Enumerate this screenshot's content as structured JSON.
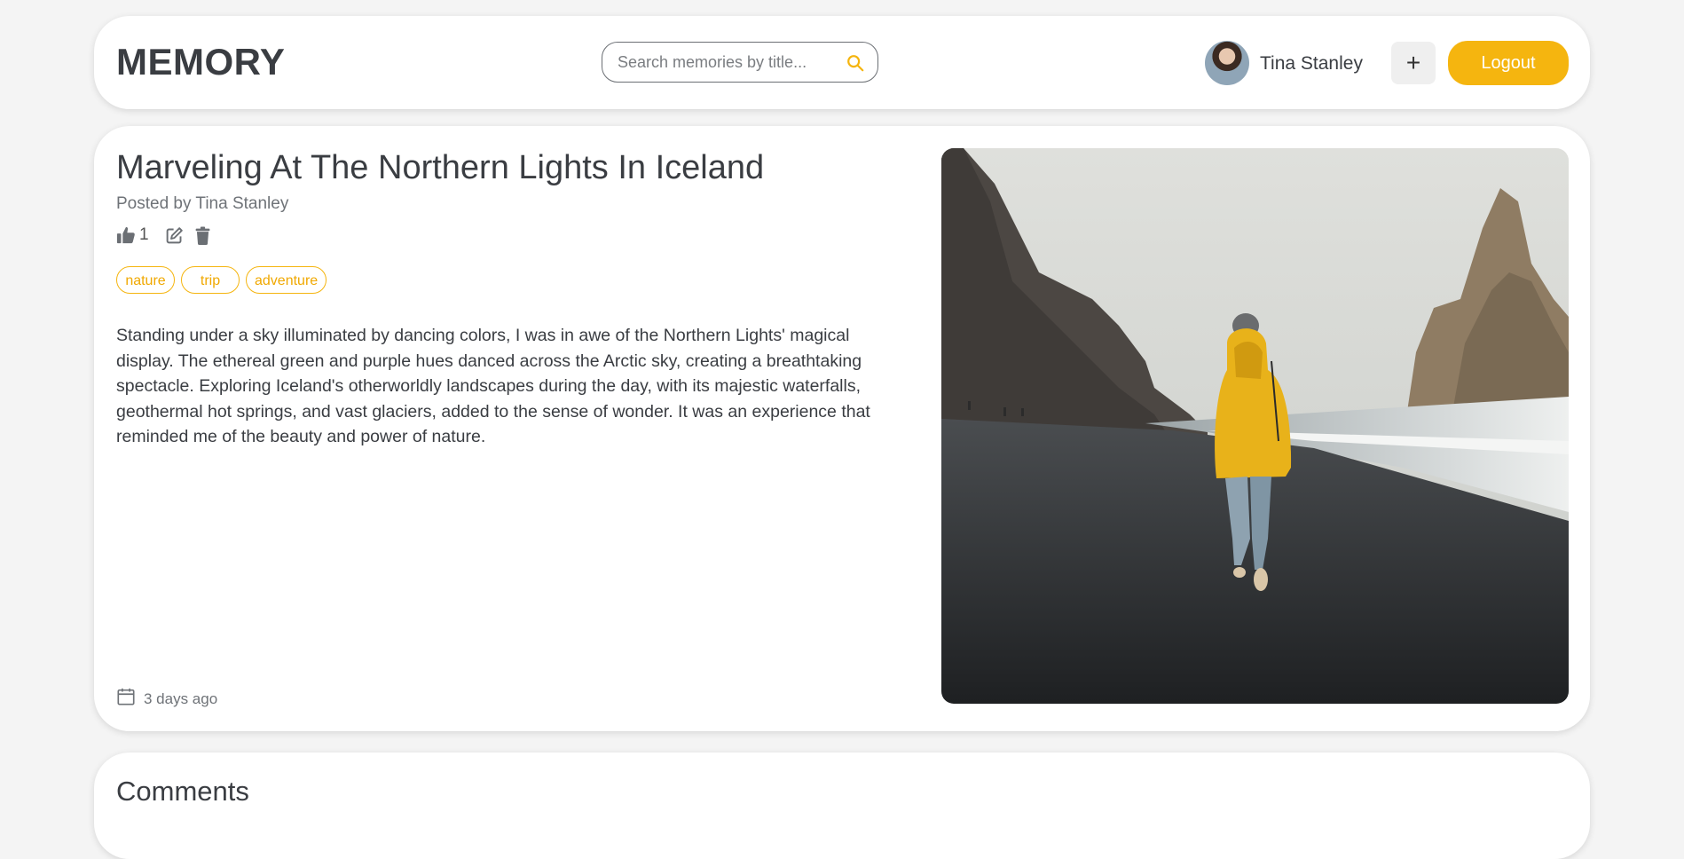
{
  "header": {
    "logo": "MEMORY",
    "search_placeholder": "Search memories by title...",
    "user_name": "Tina Stanley",
    "add_label": "+",
    "logout_label": "Logout"
  },
  "memory": {
    "title": "Marveling At The Northern Lights In Iceland",
    "posted_by": "Posted by Tina Stanley",
    "likes": "1",
    "tags": [
      "nature",
      "trip",
      "adventure"
    ],
    "description": "Standing under a sky illuminated by dancing colors, I was in awe of the Northern Lights' magical display. The ethereal green and purple hues danced across the Arctic sky, creating a breathtaking spectacle. Exploring Iceland's otherworldly landscapes during the day, with its majestic waterfalls, geothermal hot springs, and vast glaciers, added to the sense of wonder. It was an experience that reminded me of the beauty and power of nature.",
    "date": "3 days ago"
  },
  "comments": {
    "title": "Comments"
  },
  "colors": {
    "accent": "#f5b50f",
    "text": "#3a3d42",
    "muted": "#6f7378",
    "background": "#f4f4f4"
  },
  "icons": {
    "search": "search-icon",
    "like": "thumbs-up-icon",
    "edit": "edit-icon",
    "delete": "trash-icon",
    "date": "calendar-icon"
  }
}
